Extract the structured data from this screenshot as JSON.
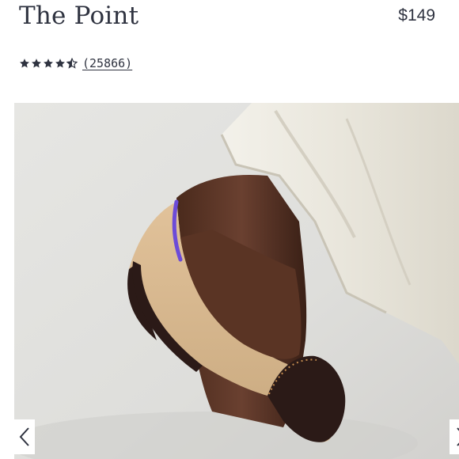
{
  "product": {
    "title": "The Point",
    "price": "$149",
    "rating": 4.5,
    "review_count": "(25866)"
  },
  "colors": {
    "text": "#2f3340",
    "star": "#2f3340",
    "shoe_upper": "#d9b98f",
    "shoe_toe": "#2b1a17",
    "heel_accent": "#6c4bd8",
    "pants": "#ece9df"
  },
  "icons": {
    "prev": "chevron-left-icon",
    "next": "chevron-right-icon",
    "star": "star-icon"
  }
}
